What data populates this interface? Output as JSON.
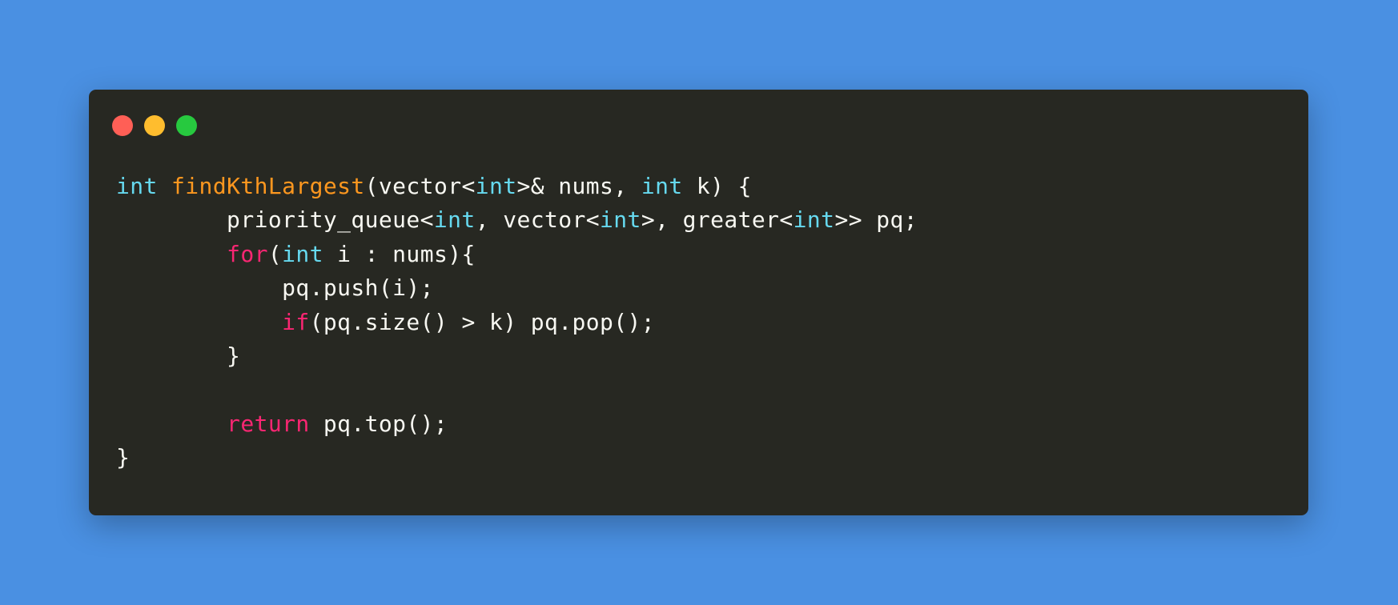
{
  "theme": {
    "background": "#4a90e2",
    "editor_bg": "#272822",
    "text": "#f8f8f2",
    "type_color": "#66d9ef",
    "function_color": "#fd971f",
    "keyword_color": "#f92672"
  },
  "window_controls": [
    {
      "name": "close",
      "color": "#ff5f56"
    },
    {
      "name": "minimize",
      "color": "#ffbd2e"
    },
    {
      "name": "maximize",
      "color": "#27c93f"
    }
  ],
  "code": {
    "lines": [
      [
        {
          "t": "int",
          "k": "type"
        },
        {
          "t": " ",
          "k": "plain"
        },
        {
          "t": "findKthLargest",
          "k": "func"
        },
        {
          "t": "(vector<",
          "k": "plain"
        },
        {
          "t": "int",
          "k": "type"
        },
        {
          "t": ">& nums, ",
          "k": "plain"
        },
        {
          "t": "int",
          "k": "type"
        },
        {
          "t": " k) {",
          "k": "plain"
        }
      ],
      [
        {
          "t": "        priority_queue<",
          "k": "plain"
        },
        {
          "t": "int",
          "k": "type"
        },
        {
          "t": ", vector<",
          "k": "plain"
        },
        {
          "t": "int",
          "k": "type"
        },
        {
          "t": ">, greater<",
          "k": "plain"
        },
        {
          "t": "int",
          "k": "type"
        },
        {
          "t": ">> pq;",
          "k": "plain"
        }
      ],
      [
        {
          "t": "        ",
          "k": "plain"
        },
        {
          "t": "for",
          "k": "kw"
        },
        {
          "t": "(",
          "k": "plain"
        },
        {
          "t": "int",
          "k": "type"
        },
        {
          "t": " i : nums){",
          "k": "plain"
        }
      ],
      [
        {
          "t": "            pq.push(i);",
          "k": "plain"
        }
      ],
      [
        {
          "t": "            ",
          "k": "plain"
        },
        {
          "t": "if",
          "k": "kw"
        },
        {
          "t": "(pq.size() > k) pq.pop();",
          "k": "plain"
        }
      ],
      [
        {
          "t": "        }",
          "k": "plain"
        }
      ],
      [
        {
          "t": "",
          "k": "plain"
        }
      ],
      [
        {
          "t": "        ",
          "k": "plain"
        },
        {
          "t": "return",
          "k": "kw"
        },
        {
          "t": " pq.top();",
          "k": "plain"
        }
      ],
      [
        {
          "t": "}",
          "k": "plain"
        }
      ]
    ]
  }
}
